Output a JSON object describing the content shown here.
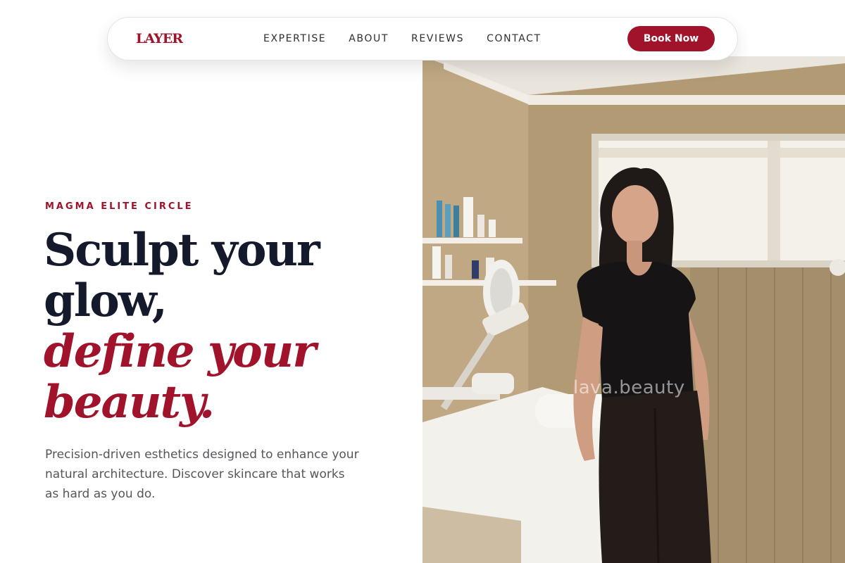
{
  "brand": {
    "logo_text": "LAYER",
    "accent_color": "#a0132a"
  },
  "nav": {
    "links": [
      "EXPERTISE",
      "ABOUT",
      "REVIEWS",
      "CONTACT"
    ],
    "cta_label": "Book Now"
  },
  "hero": {
    "eyebrow": "MAGMA ELITE CIRCLE",
    "headline_line1": "Sculpt your",
    "headline_line2": "glow,",
    "headline_accent_line1": "define your",
    "headline_accent_line2": "beauty.",
    "lead": "Precision-driven esthetics designed to enhance your natural architecture. Discover skincare that works as hard as you do.",
    "image_watermark": "lava.beauty"
  },
  "colors": {
    "heading": "#141a2b",
    "body_text": "#55555c",
    "button_bg": "#a0132a",
    "button_text": "#ffffff"
  }
}
